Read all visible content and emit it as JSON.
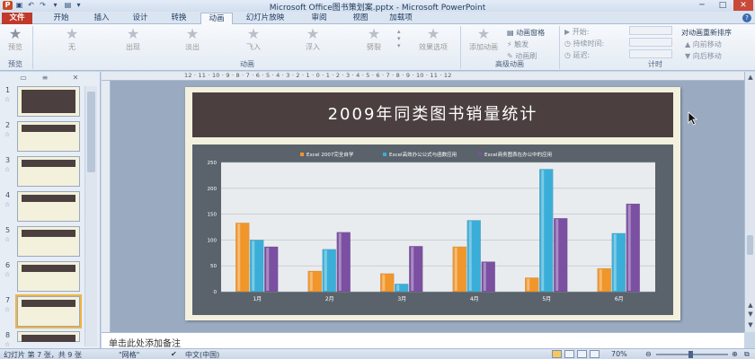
{
  "titlebar": {
    "title": "Microsoft Office图书策划案.pptx - Microsoft PowerPoint",
    "app_icon": "P"
  },
  "tabs": [
    {
      "label": "文件"
    },
    {
      "label": "开始"
    },
    {
      "label": "插入"
    },
    {
      "label": "设计"
    },
    {
      "label": "转换"
    },
    {
      "label": "动画"
    },
    {
      "label": "幻灯片放映"
    },
    {
      "label": "审阅"
    },
    {
      "label": "视图"
    },
    {
      "label": "加载项"
    }
  ],
  "ribbon": {
    "preview_label": "预览",
    "preview_group": "预览",
    "effects": [
      {
        "label": "无"
      },
      {
        "label": "出现"
      },
      {
        "label": "淡出"
      },
      {
        "label": "飞入"
      },
      {
        "label": "浮入"
      },
      {
        "label": "劈裂"
      }
    ],
    "effect_options_label": "效果选项",
    "animation_group": "动画",
    "add_animation_label": "添加动画",
    "animation_pane_label": "动画窗格",
    "trigger_label": "触发",
    "animation_painter_label": "动画刷",
    "advanced_group": "高级动画",
    "start_label": "开始:",
    "duration_label": "持续时间:",
    "delay_label": "延迟:",
    "timing_group": "计时",
    "reorder_label": "对动画重新排序",
    "move_earlier_label": "向前移动",
    "move_later_label": "向后移动"
  },
  "slides_panel": {
    "numbers": [
      "1",
      "2",
      "3",
      "4",
      "5",
      "6",
      "7",
      "8"
    ]
  },
  "ruler_text": "12 · 11 · 10 · 9 · 8 · 7 · 6 · 5 · 4 · 3 · 2 · 1 · 0 · 1 · 2 · 3 · 4 · 5 · 6 · 7 · 8 · 9 · 10 · 11 · 12",
  "slide": {
    "title": "2009年同类图书销量统计"
  },
  "chart_data": {
    "type": "bar",
    "categories": [
      "1月",
      "2月",
      "3月",
      "4月",
      "5月",
      "6月"
    ],
    "series": [
      {
        "name": "Excel 2007完全自学",
        "color": "#f0962a",
        "values": [
          133,
          40,
          35,
          87,
          27,
          45
        ]
      },
      {
        "name": "Excel高效办公公式与函数应用",
        "color": "#3aaed8",
        "values": [
          100,
          82,
          15,
          138,
          237,
          113
        ]
      },
      {
        "name": "Excel商务图表在办公中的应用",
        "color": "#7b4fa1",
        "values": [
          87,
          115,
          88,
          58,
          142,
          170
        ]
      }
    ],
    "ylim": [
      0,
      250
    ],
    "yticks": [
      0,
      50,
      100,
      150,
      200,
      250
    ],
    "legend": "top",
    "grid": true
  },
  "notes": {
    "placeholder": "单击此处添加备注"
  },
  "statusbar": {
    "slide_info": "幻灯片 第 7 张，共 9 张",
    "theme": "\"网格\"",
    "language": "中文(中国)",
    "zoom": "70%"
  }
}
